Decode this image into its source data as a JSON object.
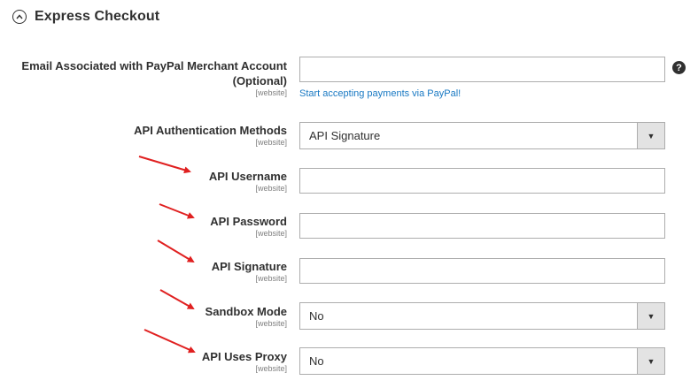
{
  "section": {
    "title": "Express Checkout",
    "collapse_icon": "chevron-up-circle-icon"
  },
  "scope_label": "[website]",
  "fields": {
    "email": {
      "label_line1": "Email Associated with PayPal Merchant Account",
      "label_line2": "(Optional)",
      "value": "",
      "link_text": "Start accepting payments via PayPal!",
      "help_icon": "?"
    },
    "auth_method": {
      "label": "API Authentication Methods",
      "value": "API Signature"
    },
    "username": {
      "label": "API Username",
      "value": ""
    },
    "password": {
      "label": "API Password",
      "value": ""
    },
    "signature": {
      "label": "API Signature",
      "value": ""
    },
    "sandbox": {
      "label": "Sandbox Mode",
      "value": "No"
    },
    "proxy": {
      "label": "API Uses Proxy",
      "value": "No"
    }
  },
  "colors": {
    "link": "#1979c3",
    "arrow": "#e02020",
    "select_arrow_bg": "#e3e3e3"
  }
}
